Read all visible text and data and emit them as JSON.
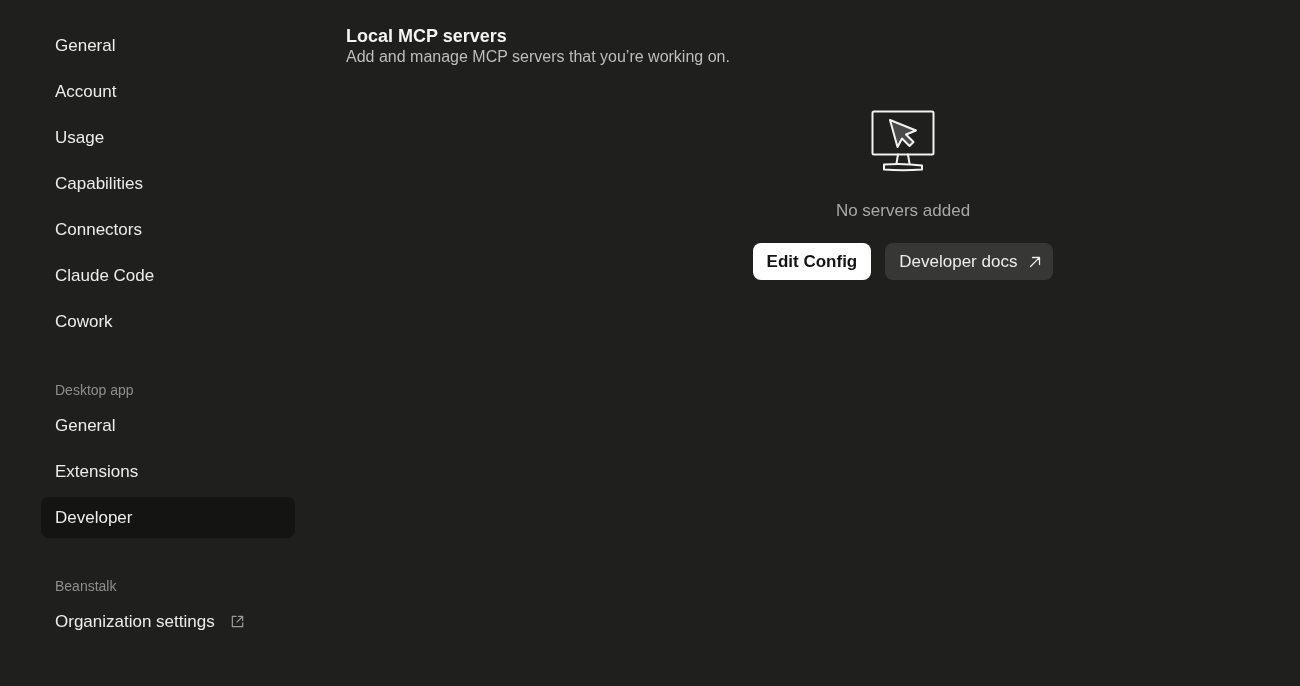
{
  "sidebar": {
    "sections": [
      {
        "items": [
          {
            "label": "General",
            "selected": false,
            "external": false
          },
          {
            "label": "Account",
            "selected": false,
            "external": false
          },
          {
            "label": "Usage",
            "selected": false,
            "external": false
          },
          {
            "label": "Capabilities",
            "selected": false,
            "external": false
          },
          {
            "label": "Connectors",
            "selected": false,
            "external": false
          },
          {
            "label": "Claude Code",
            "selected": false,
            "external": false
          },
          {
            "label": "Cowork",
            "selected": false,
            "external": false
          }
        ]
      },
      {
        "heading": "Desktop app",
        "items": [
          {
            "label": "General",
            "selected": false,
            "external": false
          },
          {
            "label": "Extensions",
            "selected": false,
            "external": false
          },
          {
            "label": "Developer",
            "selected": true,
            "external": false
          }
        ]
      },
      {
        "heading": "Beanstalk",
        "items": [
          {
            "label": "Organization settings",
            "selected": false,
            "external": true
          }
        ]
      }
    ]
  },
  "main": {
    "title": "Local MCP servers",
    "description": "Add and manage MCP servers that you’re working on.",
    "empty_state": {
      "message": "No servers added"
    },
    "buttons": [
      {
        "label": "Edit Config",
        "kind": "primary",
        "external": false
      },
      {
        "label": "Developer docs",
        "kind": "secondary",
        "external": true
      }
    ]
  }
}
